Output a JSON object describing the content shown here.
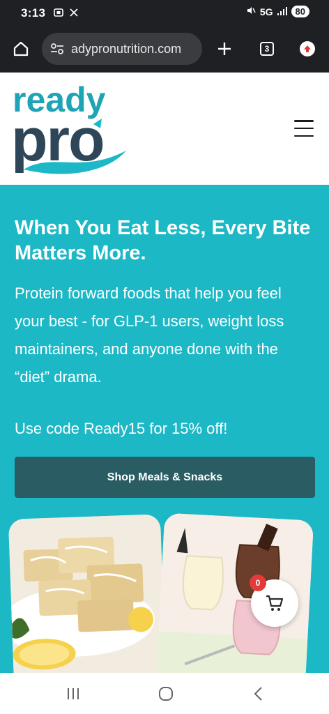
{
  "status_bar": {
    "time": "3:13",
    "network": "5G",
    "battery": "80"
  },
  "browser": {
    "url": "adypronutrition.com",
    "tab_count": "3"
  },
  "site": {
    "logo_line1": "ready",
    "logo_line2": "pro"
  },
  "hero": {
    "headline": "When You Eat Less, Every Bite Matters More.",
    "description": "Protein forward foods that help you feel your best - for GLP-1 users, weight loss maintainers, and anyone done with the “diet” drama.",
    "promo": "Use code Ready15 for 15% off!",
    "button_label": "Shop Meals & Snacks"
  },
  "cart": {
    "count": "0"
  },
  "colors": {
    "brand_teal": "#1cb8c6",
    "brand_dark": "#2a5d63",
    "logo_teal": "#1fa4b5",
    "logo_navy": "#2e4657"
  },
  "icons": [
    "home-icon",
    "tune-icon",
    "plus-icon",
    "tabs-icon",
    "update-icon",
    "menu-icon",
    "cart-icon",
    "recents-icon",
    "home-nav-icon",
    "back-icon"
  ]
}
